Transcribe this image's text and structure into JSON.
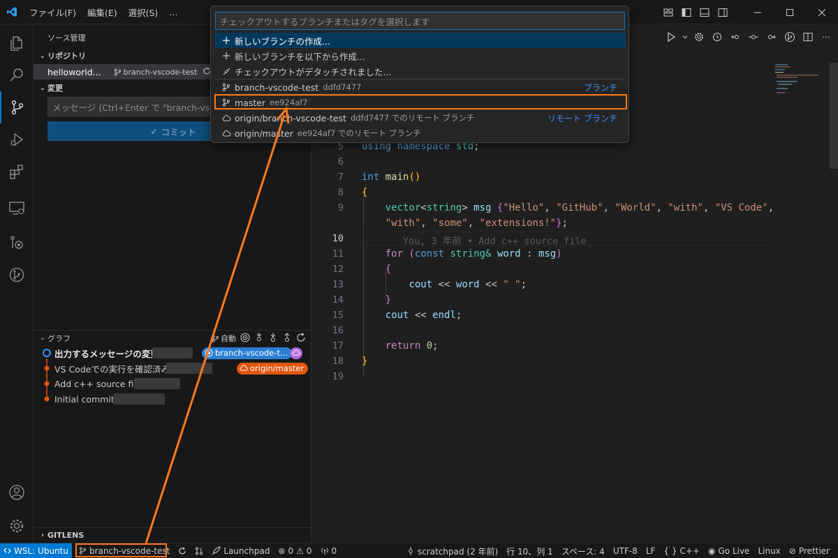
{
  "titlebar": {
    "menus": [
      "ファイル(F)",
      "編集(E)",
      "選択(S)",
      "…"
    ]
  },
  "sidebar": {
    "title": "ソース管理",
    "repositories_header": "リポジトリ",
    "repo_name": "helloworld...",
    "repo_branch": "branch-vscode-test",
    "changes_header": "変更",
    "message_placeholder": "メッセージ (Ctrl+Enter で \"branch-vscode-test\" にコミット)",
    "commit_label": "コミット",
    "graph": {
      "header": "グラフ",
      "auto_label": "自動",
      "commits": [
        {
          "message": "出力するメッセージの変更",
          "bold": true
        },
        {
          "message": "VS Codeでの実行を確認済み",
          "bold": false
        },
        {
          "message": "Add c++ source file",
          "bold": false
        },
        {
          "message": "Initial commit",
          "bold": false
        }
      ],
      "ref_local": "branch-vscode-t...",
      "ref_remote": "origin/master"
    },
    "gitlens_header": "GITLENS"
  },
  "quickpick": {
    "placeholder": "チェックアウトするブランチまたはタグを選択します",
    "actions": [
      {
        "label": "新しいブランチの作成..."
      },
      {
        "label": "新しいブランチを以下から作成..."
      },
      {
        "label": "チェックアウトがデタッチされました..."
      }
    ],
    "refs": [
      {
        "label": "branch-vscode-test",
        "desc": "ddfd7477",
        "right": "ブランチ",
        "icon": "branch"
      },
      {
        "label": "master",
        "desc": "ee924af7",
        "right": "",
        "icon": "branch"
      },
      {
        "label": "origin/branch-vscode-test",
        "desc": "ddfd7477 でのリモート ブランチ",
        "right": "リモート ブランチ",
        "icon": "cloud"
      },
      {
        "label": "origin/master",
        "desc": "ee924af7 でのリモート ブランチ",
        "right": "",
        "icon": "cloud"
      }
    ]
  },
  "editor": {
    "line_numbers": [
      "5",
      "6",
      "7",
      "8",
      "9",
      "",
      "10",
      "11",
      "12",
      "13",
      "14",
      "15",
      "16",
      "17",
      "18",
      "19"
    ],
    "current_line": "10",
    "blame": "You, 3 年前 • Add c++ source file",
    "code": {
      "l5_kw1": "using",
      "l5_kw2": "namespace",
      "l5_ns": "std",
      "l7_type": "int",
      "l7_fn": "main",
      "l9_type": "vector",
      "l9_tparam": "string",
      "l9_var": "msg",
      "l9_s1": "\"Hello\"",
      "l9_s2": "\"GitHub\"",
      "l9_s3": "\"World\"",
      "l9_s4": "\"with\"",
      "l9_s5": "\"VS Code\"",
      "l9b_s6": "\"with\"",
      "l9b_s7": "\"some\"",
      "l9b_s8": "\"extensions!\"",
      "l11_kw": "for",
      "l11_const": "const",
      "l11_type": "string&",
      "l11_var": "word",
      "l11_msg": "msg",
      "l13_cout": "cout",
      "l13_op": "<<",
      "l13_word": "word",
      "l13_s": "\" \"",
      "l15_cout": "cout",
      "l15_endl": "endl",
      "l17_ret": "return",
      "l17_num": "0"
    }
  },
  "statusbar": {
    "remote": "WSL: Ubuntu",
    "branch": "branch-vscode-test",
    "launchpad": "Launchpad",
    "errors": "0",
    "warnings": "0",
    "ports": "0",
    "blame": "scratchpad (2 年前)",
    "position": "行 10、列 1",
    "spaces": "スペース: 4",
    "encoding": "UTF-8",
    "eol": "LF",
    "language": "C++",
    "golive": "Go Live",
    "os": "Linux",
    "prettier": "Prettier"
  },
  "colors": {
    "accent": "#0078d4",
    "highlight": "#ff7a1a",
    "ref_local": "#2a7fd4",
    "ref_remote": "#e0560f"
  }
}
